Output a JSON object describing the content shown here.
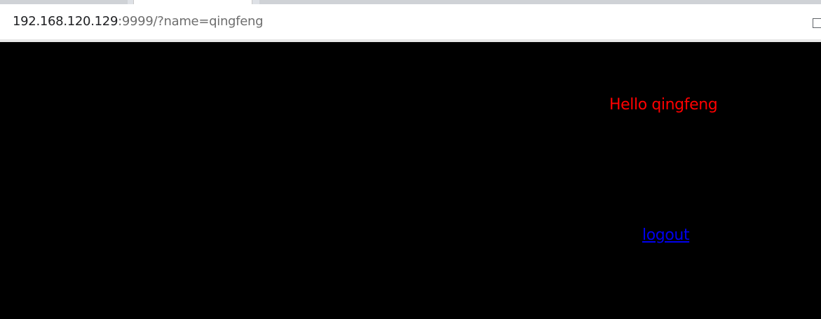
{
  "browser": {
    "url_host": "192.168.120.129",
    "url_rest": ":9999/?name=qingfeng",
    "icons": [
      "page-icon"
    ]
  },
  "page": {
    "greeting": "Hello qingfeng",
    "logout_label": "logout",
    "colors": {
      "background": "#000000",
      "greeting": "#ff0000",
      "link": "#0000ee"
    }
  }
}
